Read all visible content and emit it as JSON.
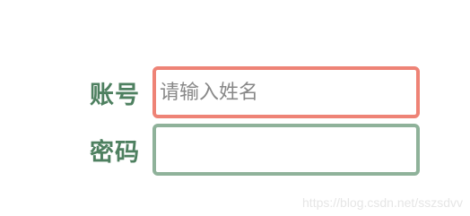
{
  "form": {
    "username": {
      "label": "账号",
      "placeholder": "请输入姓名",
      "value": "",
      "focused": true,
      "border_color": "#ee8376"
    },
    "password": {
      "label": "密码",
      "placeholder": "",
      "value": "",
      "focused": false,
      "border_color": "#8fb29a"
    }
  },
  "label_color": "#4e8060",
  "watermark": "https://blog.csdn.net/sszsdvv"
}
